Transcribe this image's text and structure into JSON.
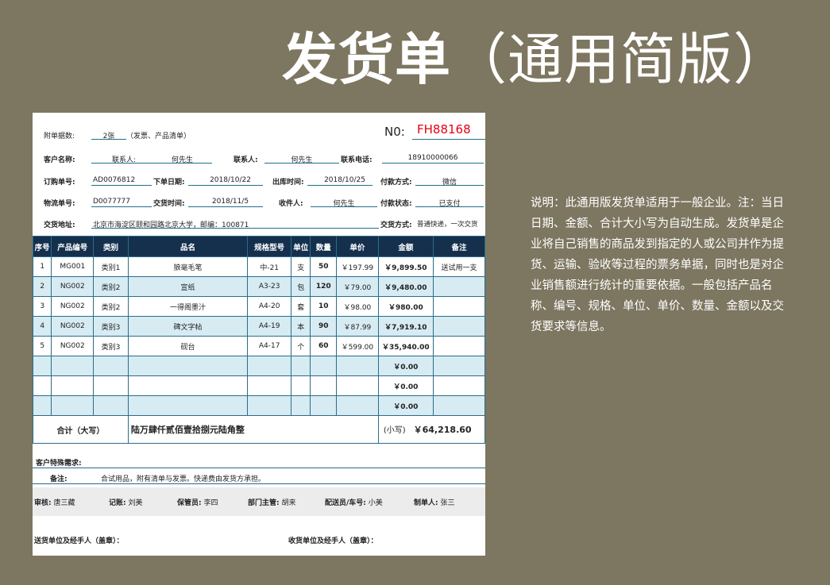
{
  "title": {
    "main": "发货单",
    "sub": "（通用简版）"
  },
  "description": "说明：此通用版发货单适用于一般企业。注：当日日期、金额、合计大小写为自动生成。发货单是企业将自己销售的商品发到指定的人或公司并作为提货、运输、验收等过程的票务单据，同时也是对企业销售额进行统计的重要依据。一般包括产品名称、编号、规格、单位、单价、数量、金额以及交货要求等信息。",
  "header": {
    "attach_label": "附单据数:",
    "attach_value": "2张",
    "attach_note": "（发票、产品清单）",
    "no_label": "N0:",
    "no_value": "FH88168",
    "customer_label": "客户名称:",
    "customer_value1": "联系人:",
    "customer_value2": "何先生",
    "contact_label": "联系人:",
    "contact_value": "何先生",
    "phone_label": "联系电话:",
    "phone_value": "18910000066",
    "order_no_label": "订购单号:",
    "order_no_value": "AD0076812",
    "order_date_label": "下单日期:",
    "order_date_value": "2018/10/22",
    "out_date_label": "出库时间:",
    "out_date_value": "2018/10/25",
    "pay_method_label": "付款方式:",
    "pay_method_value": "微信",
    "logistics_label": "物流单号:",
    "logistics_value": "D0077777",
    "delivery_time_label": "交货时间:",
    "delivery_time_value": "2018/11/5",
    "receiver_label": "收件人:",
    "receiver_value": "何先生",
    "pay_status_label": "付款状态:",
    "pay_status_value": "已支付",
    "address_label": "交货地址:",
    "address_value": "北京市海淀区颐和园路北京大学，邮编：100871",
    "delivery_method_label": "交货方式:",
    "delivery_method_value": "普通快递，一次交货"
  },
  "table": {
    "columns": [
      "序号",
      "产品编号",
      "类别",
      "品名",
      "规格型号",
      "单位",
      "数量",
      "单价",
      "金额",
      "备注"
    ],
    "rows": [
      {
        "no": "1",
        "code": "MG001",
        "cat": "类别1",
        "name": "狼毫毛笔",
        "spec": "中-21",
        "unit": "支",
        "qty": "50",
        "price": "￥197.99",
        "amount": "￥9,899.50",
        "note": "送试用一支"
      },
      {
        "no": "2",
        "code": "NG002",
        "cat": "类别2",
        "name": "宣纸",
        "spec": "A3-23",
        "unit": "包",
        "qty": "120",
        "price": "￥79.00",
        "amount": "￥9,480.00",
        "note": ""
      },
      {
        "no": "3",
        "code": "NG002",
        "cat": "类别2",
        "name": "一得阁墨汁",
        "spec": "A4-20",
        "unit": "套",
        "qty": "10",
        "price": "￥98.00",
        "amount": "￥980.00",
        "note": ""
      },
      {
        "no": "4",
        "code": "NG002",
        "cat": "类别3",
        "name": "碑文字帖",
        "spec": "A4-19",
        "unit": "本",
        "qty": "90",
        "price": "￥87.99",
        "amount": "￥7,919.10",
        "note": ""
      },
      {
        "no": "5",
        "code": "NG002",
        "cat": "类别3",
        "name": "砚台",
        "spec": "A4-17",
        "unit": "个",
        "qty": "60",
        "price": "￥599.00",
        "amount": "￥35,940.00",
        "note": ""
      },
      {
        "no": "",
        "code": "",
        "cat": "",
        "name": "",
        "spec": "",
        "unit": "",
        "qty": "",
        "price": "",
        "amount": "￥0.00",
        "note": ""
      },
      {
        "no": "",
        "code": "",
        "cat": "",
        "name": "",
        "spec": "",
        "unit": "",
        "qty": "",
        "price": "",
        "amount": "￥0.00",
        "note": ""
      },
      {
        "no": "",
        "code": "",
        "cat": "",
        "name": "",
        "spec": "",
        "unit": "",
        "qty": "",
        "price": "",
        "amount": "￥0.00",
        "note": ""
      }
    ],
    "total_label": "合计（大写）",
    "total_upper": "陆万肆仟贰佰壹拾捌元陆角整",
    "small_label": "(小写)",
    "total_small": "￥64,218.60"
  },
  "footer": {
    "special_label": "客户特殊需求:",
    "remark_label": "备注:",
    "remark_value": "合试用品，附有清单与发票。快递费由发货方承担。",
    "audit_label": "审核:",
    "audit_value": "唐三藏",
    "bookkeeper_label": "记账:",
    "bookkeeper_value": "刘美",
    "keeper_label": "保管员:",
    "keeper_value": "李四",
    "manager_label": "部门主管:",
    "manager_value": "胡来",
    "driver_label": "配送员/车号:",
    "driver_value": "小美",
    "maker_label": "制单人:",
    "maker_value": "张三",
    "sender_label": "送货单位及经手人（盖章）：",
    "recipient_label": "收货单位及经手人（盖章）："
  }
}
